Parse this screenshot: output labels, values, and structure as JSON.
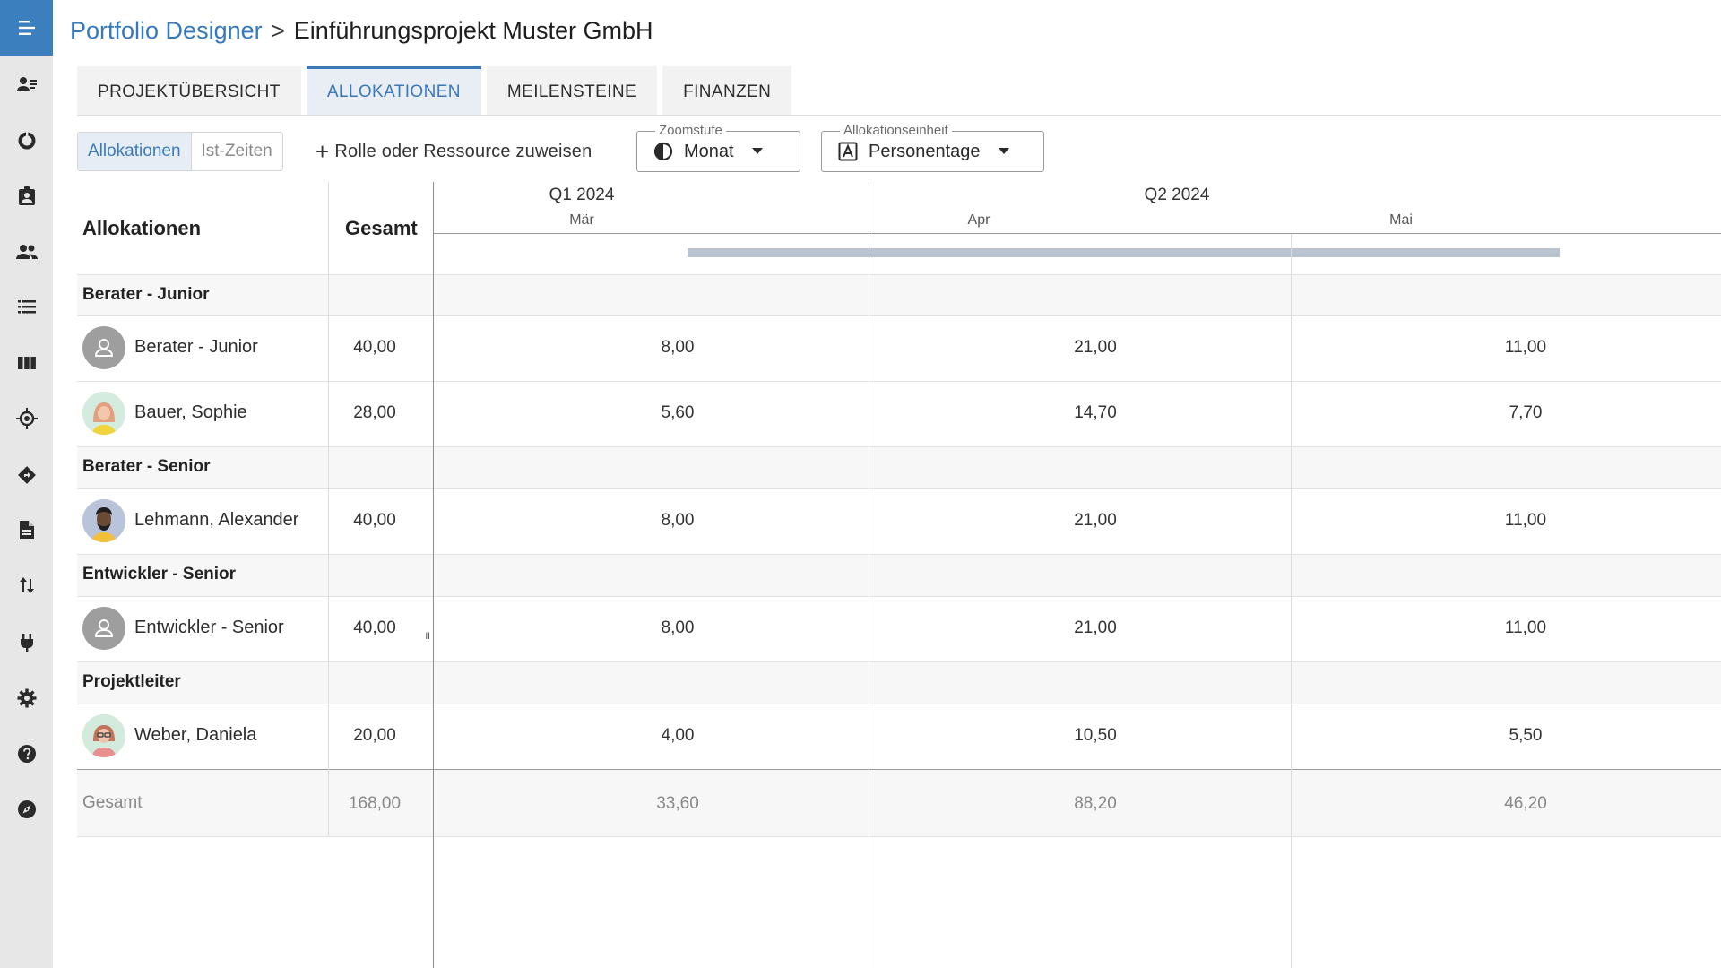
{
  "breadcrumb": {
    "parent": "Portfolio Designer",
    "separator": ">",
    "current": "Einführungsprojekt Muster GmbH"
  },
  "rail": {
    "icons": [
      "menu-icon",
      "contact-card-icon",
      "donut-chart-icon",
      "badge-icon",
      "people-icon",
      "list-icon",
      "columns-icon",
      "target-icon",
      "diamond-arrow-icon",
      "document-icon",
      "sort-arrows-icon",
      "plug-icon",
      "gear-icon",
      "help-icon",
      "compass-icon"
    ],
    "colors": {
      "rail_bg": "#e7e7e7",
      "menu_bg": "#3b7fbf",
      "icon": "#2a2a2a"
    }
  },
  "tabs": [
    {
      "label": "PROJEKTÜBERSICHT",
      "active": false
    },
    {
      "label": "ALLOKATIONEN",
      "active": true
    },
    {
      "label": "MEILENSTEINE",
      "active": false
    },
    {
      "label": "FINANZEN",
      "active": false
    }
  ],
  "toolbar": {
    "toggle_on": "Allokationen",
    "toggle_off": "Ist-Zeiten",
    "assign_label": "Rolle oder Ressource zuweisen",
    "zoom_legend": "Zoomstufe",
    "zoom_value": "Monat",
    "unit_legend": "Allokationseinheit",
    "unit_value": "Personentage"
  },
  "grid": {
    "col_allocations": "Allokationen",
    "col_total": "Gesamt",
    "quarters": [
      "Q1 2024",
      "Q2 2024"
    ],
    "months": [
      "Mär",
      "Apr",
      "Mai"
    ],
    "groups": [
      {
        "label": "Berater - Junior",
        "rows": [
          {
            "name": "Berater - Junior",
            "avatar": "placeholder",
            "total": "40,00",
            "values": [
              "8,00",
              "21,00",
              "11,00"
            ]
          },
          {
            "name": "Bauer, Sophie",
            "avatar": "woman-blonde",
            "total": "28,00",
            "values": [
              "5,60",
              "14,70",
              "7,70"
            ]
          }
        ]
      },
      {
        "label": "Berater - Senior",
        "rows": [
          {
            "name": "Lehmann, Alexander",
            "avatar": "man-beard",
            "total": "40,00",
            "values": [
              "8,00",
              "21,00",
              "11,00"
            ]
          }
        ]
      },
      {
        "label": "Entwickler - Senior",
        "rows": [
          {
            "name": "Entwickler - Senior",
            "avatar": "placeholder",
            "total": "40,00",
            "values": [
              "8,00",
              "21,00",
              "11,00"
            ]
          }
        ]
      },
      {
        "label": "Projektleiter",
        "rows": [
          {
            "name": "Weber, Daniela",
            "avatar": "woman-glasses",
            "total": "20,00",
            "values": [
              "4,00",
              "10,50",
              "5,50"
            ]
          }
        ]
      }
    ],
    "totals": {
      "label": "Gesamt",
      "total": "168,00",
      "values": [
        "33,60",
        "88,20",
        "46,20"
      ]
    }
  }
}
